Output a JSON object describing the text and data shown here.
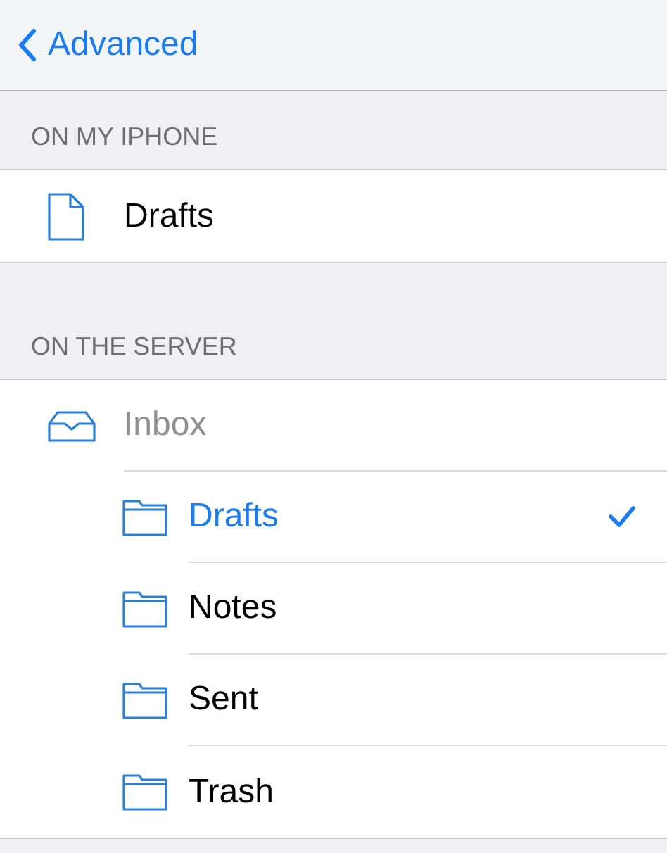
{
  "nav": {
    "back_label": "Advanced"
  },
  "sections": [
    {
      "header": "ON MY IPHONE",
      "items": [
        {
          "kind": "document",
          "label": "Drafts",
          "disabled": false,
          "selected": false
        }
      ]
    },
    {
      "header": "ON THE SERVER",
      "items": [
        {
          "kind": "inbox",
          "label": "Inbox",
          "disabled": true,
          "selected": false,
          "children": [
            {
              "kind": "folder",
              "label": "Drafts",
              "disabled": false,
              "selected": true
            },
            {
              "kind": "folder",
              "label": "Notes",
              "disabled": false,
              "selected": false
            },
            {
              "kind": "folder",
              "label": "Sent",
              "disabled": false,
              "selected": false
            },
            {
              "kind": "folder",
              "label": "Trash",
              "disabled": false,
              "selected": false
            }
          ]
        }
      ]
    }
  ]
}
